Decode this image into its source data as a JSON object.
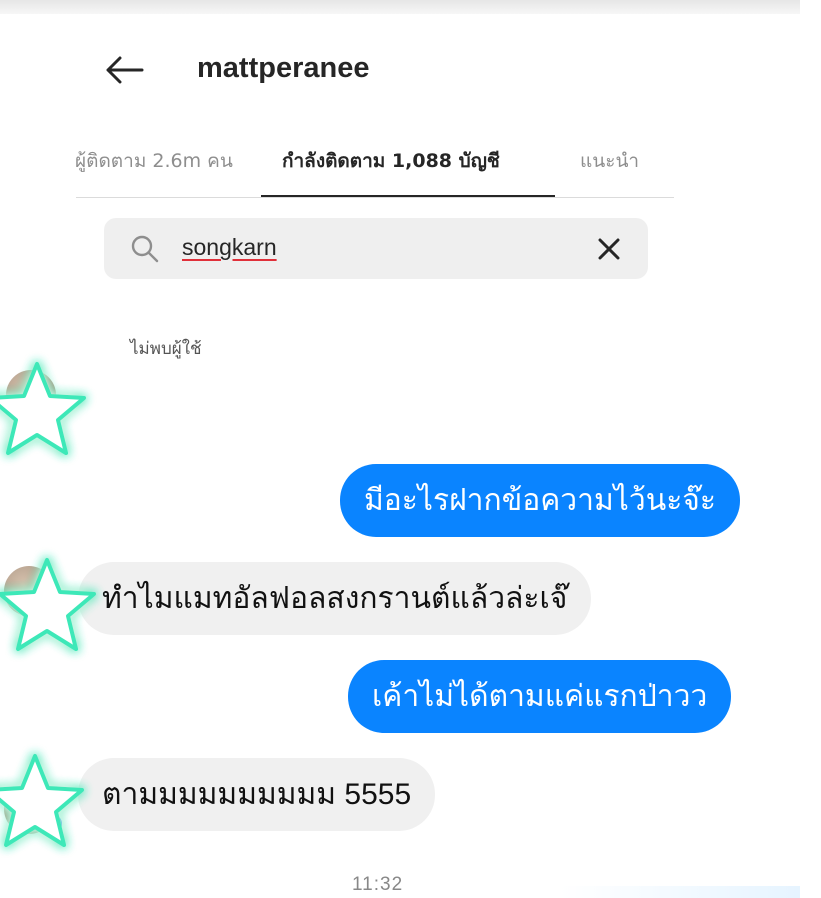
{
  "profile": {
    "username": "mattperanee"
  },
  "tabs": {
    "followers": "ผู้ติดตาม 2.6m คน",
    "following": "กำลังติดตาม 1,088 บัญชี",
    "suggested": "แนะนำ"
  },
  "search": {
    "query": "songkarn"
  },
  "results": {
    "empty_text": "ไม่พบผู้ใช้"
  },
  "messages": [
    {
      "direction": "outgoing",
      "text": "มีอะไรฝากข้อความไว้นะจ๊ะ"
    },
    {
      "direction": "incoming",
      "text": "ทำไมแมทอัลฟอลสงกรานต์แล้วล่ะเจ๊"
    },
    {
      "direction": "outgoing",
      "text": "เค้าไม่ได้ตามแค่แรกป่าวว"
    },
    {
      "direction": "incoming",
      "text": "ตามมมมมมมมมม 5555"
    }
  ],
  "timestamp": "11:32",
  "colors": {
    "outgoing_bubble": "#0a84ff",
    "incoming_bubble": "#f0f0f0",
    "star_glow": "#3ee8b8",
    "verified": "#1877f2"
  },
  "icons": [
    "back-arrow-icon",
    "search-icon",
    "clear-icon",
    "star-sticker-icon",
    "verified-icon"
  ]
}
